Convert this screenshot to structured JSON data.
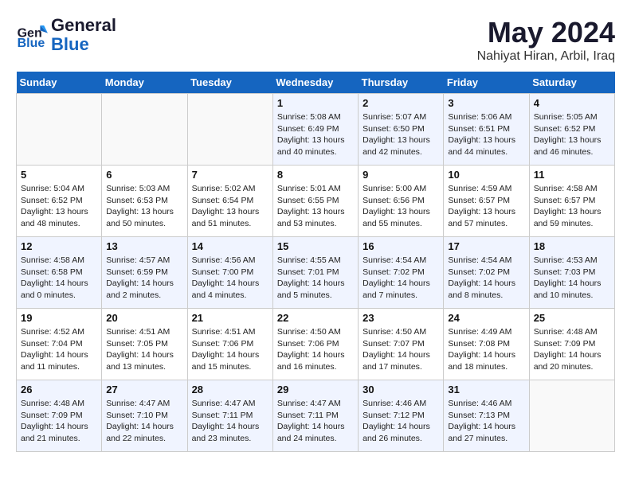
{
  "header": {
    "logo_line1": "General",
    "logo_line2": "Blue",
    "month": "May 2024",
    "location": "Nahiyat Hiran, Arbil, Iraq"
  },
  "weekdays": [
    "Sunday",
    "Monday",
    "Tuesday",
    "Wednesday",
    "Thursday",
    "Friday",
    "Saturday"
  ],
  "weeks": [
    [
      {
        "day": "",
        "info": ""
      },
      {
        "day": "",
        "info": ""
      },
      {
        "day": "",
        "info": ""
      },
      {
        "day": "1",
        "info": "Sunrise: 5:08 AM\nSunset: 6:49 PM\nDaylight: 13 hours and 40 minutes."
      },
      {
        "day": "2",
        "info": "Sunrise: 5:07 AM\nSunset: 6:50 PM\nDaylight: 13 hours and 42 minutes."
      },
      {
        "day": "3",
        "info": "Sunrise: 5:06 AM\nSunset: 6:51 PM\nDaylight: 13 hours and 44 minutes."
      },
      {
        "day": "4",
        "info": "Sunrise: 5:05 AM\nSunset: 6:52 PM\nDaylight: 13 hours and 46 minutes."
      }
    ],
    [
      {
        "day": "5",
        "info": "Sunrise: 5:04 AM\nSunset: 6:52 PM\nDaylight: 13 hours and 48 minutes."
      },
      {
        "day": "6",
        "info": "Sunrise: 5:03 AM\nSunset: 6:53 PM\nDaylight: 13 hours and 50 minutes."
      },
      {
        "day": "7",
        "info": "Sunrise: 5:02 AM\nSunset: 6:54 PM\nDaylight: 13 hours and 51 minutes."
      },
      {
        "day": "8",
        "info": "Sunrise: 5:01 AM\nSunset: 6:55 PM\nDaylight: 13 hours and 53 minutes."
      },
      {
        "day": "9",
        "info": "Sunrise: 5:00 AM\nSunset: 6:56 PM\nDaylight: 13 hours and 55 minutes."
      },
      {
        "day": "10",
        "info": "Sunrise: 4:59 AM\nSunset: 6:57 PM\nDaylight: 13 hours and 57 minutes."
      },
      {
        "day": "11",
        "info": "Sunrise: 4:58 AM\nSunset: 6:57 PM\nDaylight: 13 hours and 59 minutes."
      }
    ],
    [
      {
        "day": "12",
        "info": "Sunrise: 4:58 AM\nSunset: 6:58 PM\nDaylight: 14 hours and 0 minutes."
      },
      {
        "day": "13",
        "info": "Sunrise: 4:57 AM\nSunset: 6:59 PM\nDaylight: 14 hours and 2 minutes."
      },
      {
        "day": "14",
        "info": "Sunrise: 4:56 AM\nSunset: 7:00 PM\nDaylight: 14 hours and 4 minutes."
      },
      {
        "day": "15",
        "info": "Sunrise: 4:55 AM\nSunset: 7:01 PM\nDaylight: 14 hours and 5 minutes."
      },
      {
        "day": "16",
        "info": "Sunrise: 4:54 AM\nSunset: 7:02 PM\nDaylight: 14 hours and 7 minutes."
      },
      {
        "day": "17",
        "info": "Sunrise: 4:54 AM\nSunset: 7:02 PM\nDaylight: 14 hours and 8 minutes."
      },
      {
        "day": "18",
        "info": "Sunrise: 4:53 AM\nSunset: 7:03 PM\nDaylight: 14 hours and 10 minutes."
      }
    ],
    [
      {
        "day": "19",
        "info": "Sunrise: 4:52 AM\nSunset: 7:04 PM\nDaylight: 14 hours and 11 minutes."
      },
      {
        "day": "20",
        "info": "Sunrise: 4:51 AM\nSunset: 7:05 PM\nDaylight: 14 hours and 13 minutes."
      },
      {
        "day": "21",
        "info": "Sunrise: 4:51 AM\nSunset: 7:06 PM\nDaylight: 14 hours and 15 minutes."
      },
      {
        "day": "22",
        "info": "Sunrise: 4:50 AM\nSunset: 7:06 PM\nDaylight: 14 hours and 16 minutes."
      },
      {
        "day": "23",
        "info": "Sunrise: 4:50 AM\nSunset: 7:07 PM\nDaylight: 14 hours and 17 minutes."
      },
      {
        "day": "24",
        "info": "Sunrise: 4:49 AM\nSunset: 7:08 PM\nDaylight: 14 hours and 18 minutes."
      },
      {
        "day": "25",
        "info": "Sunrise: 4:48 AM\nSunset: 7:09 PM\nDaylight: 14 hours and 20 minutes."
      }
    ],
    [
      {
        "day": "26",
        "info": "Sunrise: 4:48 AM\nSunset: 7:09 PM\nDaylight: 14 hours and 21 minutes."
      },
      {
        "day": "27",
        "info": "Sunrise: 4:47 AM\nSunset: 7:10 PM\nDaylight: 14 hours and 22 minutes."
      },
      {
        "day": "28",
        "info": "Sunrise: 4:47 AM\nSunset: 7:11 PM\nDaylight: 14 hours and 23 minutes."
      },
      {
        "day": "29",
        "info": "Sunrise: 4:47 AM\nSunset: 7:11 PM\nDaylight: 14 hours and 24 minutes."
      },
      {
        "day": "30",
        "info": "Sunrise: 4:46 AM\nSunset: 7:12 PM\nDaylight: 14 hours and 26 minutes."
      },
      {
        "day": "31",
        "info": "Sunrise: 4:46 AM\nSunset: 7:13 PM\nDaylight: 14 hours and 27 minutes."
      },
      {
        "day": "",
        "info": ""
      }
    ]
  ]
}
